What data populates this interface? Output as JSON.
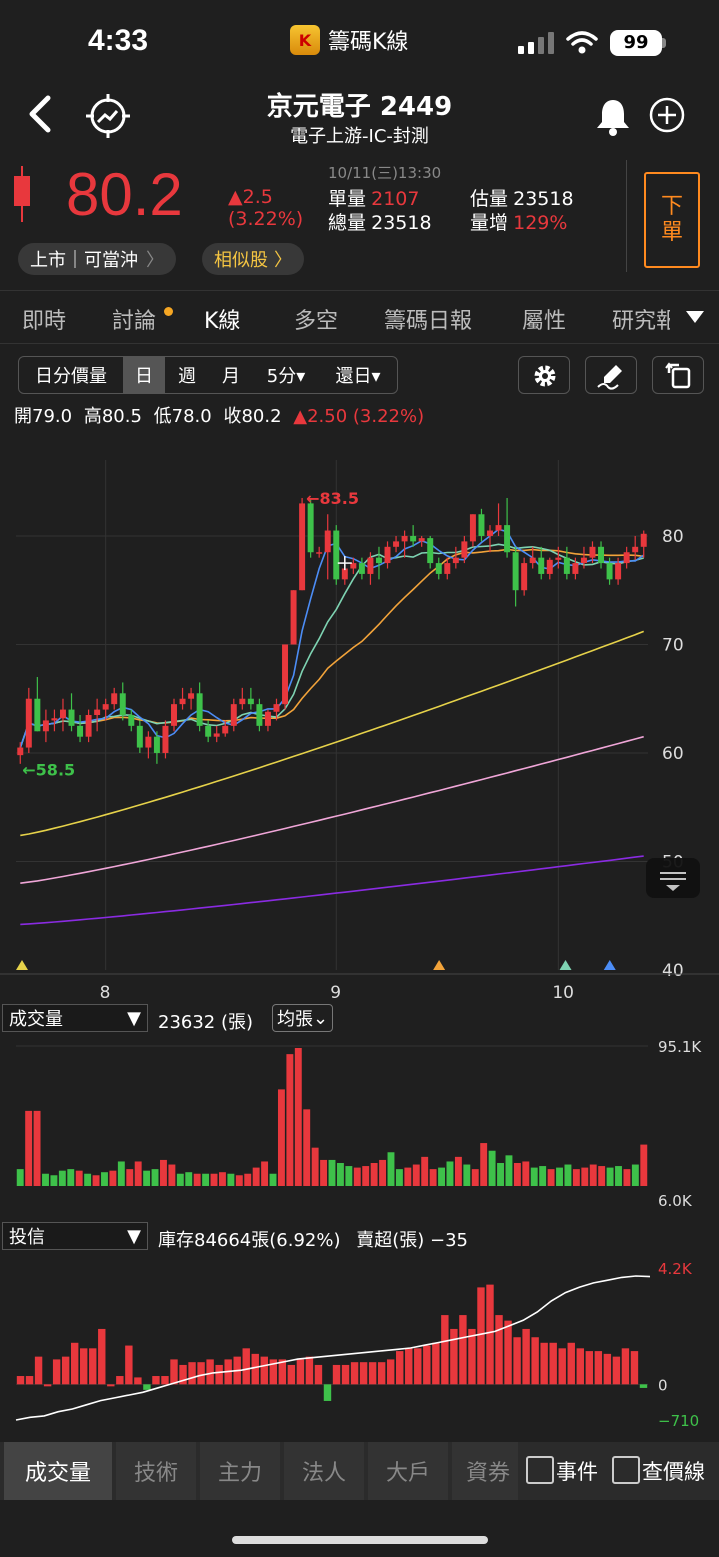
{
  "status": {
    "time": "4:33",
    "app_name": "籌碼K線",
    "app_logo_letter": "K",
    "battery": "99"
  },
  "header": {
    "title": "京元電子 2449",
    "subtitle": "電子上游-IC-封測"
  },
  "quote": {
    "price": "80.2",
    "change": "▲2.5",
    "change_pct": "(3.22%)",
    "datetime": "10/11(三)13:30",
    "unit_vol_label": "單量",
    "unit_vol": "2107",
    "total_vol_label": "總量",
    "total_vol": "23518",
    "est_vol_label": "估量",
    "est_vol": "23518",
    "vol_inc_label": "量增",
    "vol_inc": "129%",
    "sell_label": "下\n單",
    "market_pill": "上市｜可當沖",
    "similar_pill": "相似股"
  },
  "tabs": [
    "即時",
    "討論",
    "K線",
    "多空",
    "籌碼日報",
    "屬性",
    "研究報"
  ],
  "toolbar": {
    "segments": [
      "日分價量",
      "日",
      "週",
      "月",
      "5分▾",
      "還日▾"
    ],
    "ohlc": {
      "open_label": "開",
      "open": "79.0",
      "high_label": "高",
      "high": "80.5",
      "low_label": "低",
      "low": "78.0",
      "close_label": "收",
      "close": "80.2",
      "chg": "▲2.50 (3.22%)"
    }
  },
  "colors": {
    "up": "#e8383d",
    "down": "#3ec14a",
    "ma5": "#4c8df6",
    "ma10": "#7ed3b2",
    "ma20": "#f2a33a",
    "ma60": "#e6d24a",
    "ma120": "#f0a6d8",
    "ma240": "#8a2be2",
    "accent": "#ff8a1f"
  },
  "chart_data": [
    {
      "type": "candlestick",
      "y_ticks": [
        "80",
        "70",
        "60",
        "50",
        "40"
      ],
      "ylim": [
        40,
        87
      ],
      "x_ticks": [
        "8",
        "9",
        "10"
      ],
      "annotations": {
        "high": "←83.5",
        "low": "←58.5"
      },
      "candles": [
        [
          59.8,
          61,
          59,
          60.5
        ],
        [
          60.5,
          66,
          60,
          65
        ],
        [
          65,
          67,
          62,
          62
        ],
        [
          62,
          64,
          61,
          63
        ],
        [
          63,
          64,
          62,
          63.2
        ],
        [
          63.2,
          65,
          62,
          64
        ],
        [
          64,
          65.5,
          62,
          62.5
        ],
        [
          62.5,
          63.5,
          61,
          61.5
        ],
        [
          61.5,
          64,
          61,
          63.5
        ],
        [
          63.5,
          65,
          62,
          64
        ],
        [
          64,
          65,
          63,
          64.5
        ],
        [
          64.5,
          66,
          64,
          65.5
        ],
        [
          65.5,
          66.5,
          63,
          63.5
        ],
        [
          63.5,
          64,
          62,
          62.5
        ],
        [
          62.5,
          63,
          60,
          60.5
        ],
        [
          60.5,
          62,
          59.5,
          61.5
        ],
        [
          61.5,
          62,
          59,
          60
        ],
        [
          60,
          63,
          59.5,
          62.5
        ],
        [
          62.5,
          65,
          62,
          64.5
        ],
        [
          64.5,
          66,
          64,
          65
        ],
        [
          65,
          66,
          64,
          65.5
        ],
        [
          65.5,
          66.5,
          62,
          62.5
        ],
        [
          62.5,
          63,
          61,
          61.5
        ],
        [
          61.5,
          62.5,
          61,
          61.8
        ],
        [
          61.8,
          63,
          61.5,
          62.5
        ],
        [
          62.5,
          65,
          62,
          64.5
        ],
        [
          64.5,
          66,
          64,
          65
        ],
        [
          65,
          66,
          64,
          64.5
        ],
        [
          64.5,
          65,
          62,
          62.5
        ],
        [
          62.5,
          64,
          62,
          63.8
        ],
        [
          63.8,
          65,
          63,
          64.5
        ],
        [
          64.5,
          70,
          64,
          70
        ],
        [
          70,
          75,
          70,
          75
        ],
        [
          75,
          83.5,
          75,
          83
        ],
        [
          83,
          83.5,
          78,
          78.5
        ],
        [
          78.5,
          79,
          78,
          78.5
        ],
        [
          78.5,
          82,
          76,
          80.5
        ],
        [
          80.5,
          81,
          75.5,
          76
        ],
        [
          76,
          78,
          75.5,
          77
        ],
        [
          77,
          78,
          76.5,
          77.5
        ],
        [
          77.5,
          78,
          76,
          76.5
        ],
        [
          76.5,
          78.5,
          75.5,
          78
        ],
        [
          78,
          79,
          76,
          77.5
        ],
        [
          77.5,
          79.5,
          77,
          79
        ],
        [
          79,
          80,
          78.5,
          79.5
        ],
        [
          79.5,
          80.5,
          78,
          80
        ],
        [
          80,
          81,
          79,
          79.5
        ],
        [
          79.5,
          80,
          79,
          79.8
        ],
        [
          79.8,
          80,
          77,
          77.5
        ],
        [
          77.5,
          78,
          76,
          76.5
        ],
        [
          76.5,
          78,
          76,
          77.5
        ],
        [
          77.5,
          79,
          77,
          78
        ],
        [
          78,
          80,
          77.5,
          79.5
        ],
        [
          79.5,
          82,
          79,
          82
        ],
        [
          82,
          82.5,
          79.5,
          80
        ],
        [
          80,
          81,
          78.5,
          80.5
        ],
        [
          80.5,
          83,
          80,
          81
        ],
        [
          81,
          83.5,
          78,
          78.5
        ],
        [
          78.5,
          79,
          73.5,
          75
        ],
        [
          75,
          78,
          74.5,
          77.5
        ],
        [
          77.5,
          79,
          77,
          78
        ],
        [
          78,
          79,
          76,
          76.5
        ],
        [
          76.5,
          78,
          76,
          77.8
        ],
        [
          77.8,
          79,
          77,
          78
        ],
        [
          78,
          79,
          76,
          76.5
        ],
        [
          76.5,
          78,
          76,
          77.5
        ],
        [
          77.5,
          79,
          77,
          78
        ],
        [
          78,
          79.5,
          77.5,
          79
        ],
        [
          79,
          79.5,
          77,
          77.5
        ],
        [
          77.5,
          78,
          75.5,
          76
        ],
        [
          76,
          78,
          75.5,
          77.5
        ],
        [
          77.5,
          79,
          77,
          78.5
        ],
        [
          78.5,
          80,
          77.8,
          79
        ],
        [
          79,
          80.5,
          78,
          80.2
        ]
      ],
      "event_markers": [
        {
          "pos": 0.0,
          "color": "#e6d24a"
        },
        {
          "pos": 0.66,
          "color": "#f2a33a"
        },
        {
          "pos": 0.86,
          "color": "#7ed3b2"
        },
        {
          "pos": 0.93,
          "color": "#4c8df6"
        }
      ]
    },
    {
      "type": "bar",
      "name": "成交量",
      "info": "23632 (張)",
      "avg_label": "均張",
      "y_ticks": [
        "95.1K",
        "6.0K"
      ],
      "values": [
        [
          11,
          0
        ],
        [
          49,
          1
        ],
        [
          49,
          1
        ],
        [
          8,
          0
        ],
        [
          7,
          0
        ],
        [
          10,
          0
        ],
        [
          11,
          0
        ],
        [
          10,
          1
        ],
        [
          8,
          0
        ],
        [
          7,
          1
        ],
        [
          9,
          0
        ],
        [
          10,
          1
        ],
        [
          16,
          0
        ],
        [
          11,
          1
        ],
        [
          16,
          1
        ],
        [
          10,
          0
        ],
        [
          11,
          0
        ],
        [
          17,
          1
        ],
        [
          14,
          1
        ],
        [
          8,
          0
        ],
        [
          9,
          0
        ],
        [
          8,
          1
        ],
        [
          8,
          0
        ],
        [
          8,
          1
        ],
        [
          9,
          1
        ],
        [
          8,
          0
        ],
        [
          7,
          1
        ],
        [
          8,
          1
        ],
        [
          12,
          1
        ],
        [
          16,
          1
        ],
        [
          8,
          0
        ],
        [
          63,
          1
        ],
        [
          86,
          1
        ],
        [
          90,
          1
        ],
        [
          50,
          1
        ],
        [
          25,
          1
        ],
        [
          17,
          1
        ],
        [
          17,
          0
        ],
        [
          15,
          0
        ],
        [
          13,
          0
        ],
        [
          12,
          1
        ],
        [
          13,
          1
        ],
        [
          15,
          1
        ],
        [
          17,
          1
        ],
        [
          22,
          0
        ],
        [
          11,
          0
        ],
        [
          12,
          1
        ],
        [
          14,
          1
        ],
        [
          19,
          1
        ],
        [
          11,
          1
        ],
        [
          12,
          0
        ],
        [
          16,
          0
        ],
        [
          19,
          1
        ],
        [
          14,
          0
        ],
        [
          11,
          1
        ],
        [
          28,
          1
        ],
        [
          23,
          0
        ],
        [
          15,
          0
        ],
        [
          20,
          0
        ],
        [
          15,
          1
        ],
        [
          16,
          1
        ],
        [
          12,
          0
        ],
        [
          13,
          0
        ],
        [
          11,
          1
        ],
        [
          12,
          0
        ],
        [
          14,
          0
        ],
        [
          11,
          1
        ],
        [
          12,
          1
        ],
        [
          14,
          1
        ],
        [
          13,
          1
        ],
        [
          12,
          0
        ],
        [
          13,
          0
        ],
        [
          11,
          1
        ],
        [
          14,
          0
        ],
        [
          27,
          1
        ]
      ]
    },
    {
      "type": "bar+line",
      "name": "投信",
      "info": "庫存84664張(6.92%)",
      "oversold_label": "賣超(張)",
      "oversold": "−35",
      "y_ticks": [
        "4.2K",
        "0",
        "−710"
      ],
      "ylim": [
        -710,
        4200
      ],
      "values": [
        300,
        300,
        1000,
        0,
        900,
        1000,
        1500,
        1300,
        1300,
        2000,
        0,
        300,
        1400,
        250,
        -200,
        300,
        300,
        900,
        700,
        800,
        800,
        900,
        700,
        900,
        1000,
        1300,
        1100,
        1000,
        900,
        900,
        700,
        900,
        1000,
        700,
        -600,
        700,
        700,
        800,
        800,
        800,
        800,
        900,
        1200,
        1300,
        1300,
        1400,
        1500,
        2500,
        2000,
        2500,
        2000,
        3500,
        3600,
        2500,
        2300,
        1700,
        2000,
        1700,
        1500,
        1500,
        1300,
        1500,
        1300,
        1200,
        1200,
        1100,
        1000,
        1300,
        1200,
        -130
      ],
      "cumulative": [
        -1000,
        -900,
        -850,
        -700,
        -600,
        -450,
        -300,
        -200,
        -100,
        0,
        150,
        300,
        450,
        600,
        700,
        750,
        800,
        900,
        1000,
        1100,
        1200,
        1250,
        1300,
        1350,
        1400,
        1450,
        1500,
        1550,
        1600,
        1700,
        1800,
        1900,
        2000,
        2100,
        2200,
        2400,
        2600,
        2900,
        3300,
        3600,
        3800,
        3950,
        4050,
        4150,
        4200,
        4180
      ]
    }
  ],
  "bottom_nav": {
    "items": [
      "成交量",
      "技術",
      "主力",
      "法人",
      "大戶",
      "資券"
    ],
    "events": "事件",
    "price_line": "查價線"
  }
}
